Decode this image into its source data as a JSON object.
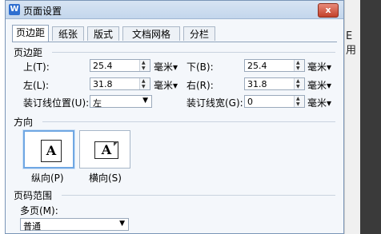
{
  "window": {
    "title": "页面设置",
    "app_icon": "W",
    "close": "x"
  },
  "background": {
    "right_glyph_top": "E",
    "right_glyph_bottom": "用"
  },
  "tabs": [
    {
      "label": "页边距",
      "active": true
    },
    {
      "label": "纸张"
    },
    {
      "label": "版式"
    },
    {
      "label": "文档网格"
    },
    {
      "label": "分栏"
    }
  ],
  "margins": {
    "section_title": "页边距",
    "top": {
      "label": "上(T):",
      "value": "25.4",
      "unit": "毫米▾"
    },
    "bottom": {
      "label": "下(B):",
      "value": "25.4",
      "unit": "毫米▾"
    },
    "left": {
      "label": "左(L):",
      "value": "31.8",
      "unit": "毫米▾"
    },
    "right": {
      "label": "右(R):",
      "value": "31.8",
      "unit": "毫米▾"
    },
    "gutter_pos": {
      "label": "装订线位置(U):",
      "value": "左"
    },
    "gutter_width": {
      "label": "装订线宽(G):",
      "value": "0",
      "unit": "毫米▾"
    }
  },
  "orientation": {
    "section_title": "方向",
    "portrait": {
      "label": "纵向(P)",
      "glyph": "A"
    },
    "landscape": {
      "label": "横向(S)",
      "glyph": "A"
    }
  },
  "page_range": {
    "section_title": "页码范围",
    "multi_label": "多页(M):",
    "multi_value": "普通"
  }
}
